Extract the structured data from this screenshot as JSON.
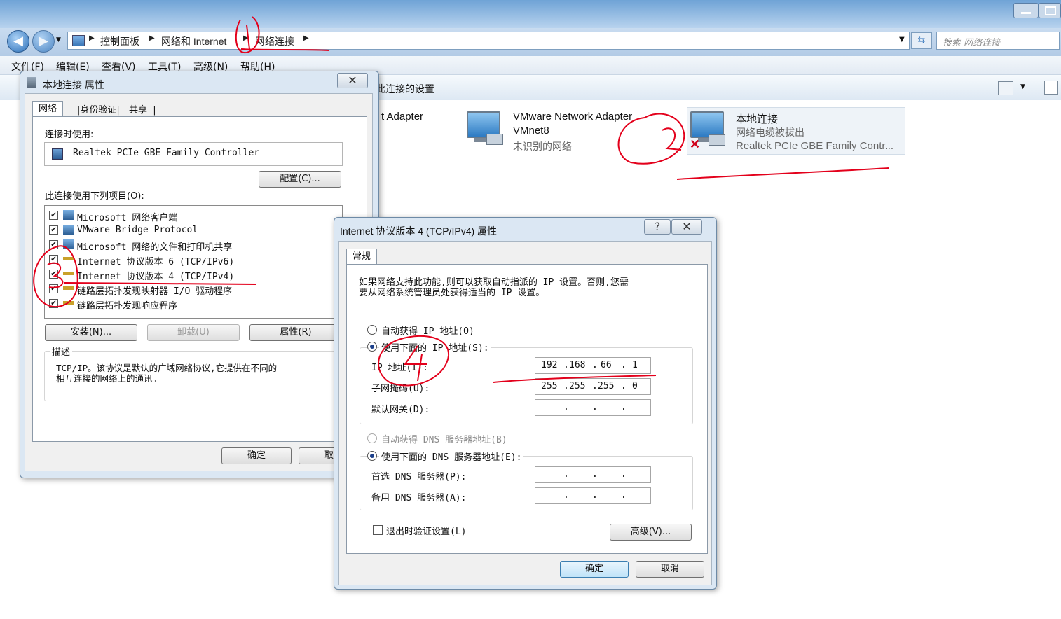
{
  "explorer": {
    "breadcrumb": [
      "控制面板",
      "网络和 Internet",
      "网络连接"
    ],
    "search_placeholder": "搜索 网络连接",
    "menus": [
      "文件(F)",
      "编辑(E)",
      "查看(V)",
      "工具(T)",
      "高级(N)",
      "帮助(H)"
    ],
    "cmd_text": "此连接的设置",
    "adapters": [
      {
        "name": "t Adapter",
        "line2": "",
        "line3": ""
      },
      {
        "name": "VMware Network Adapter",
        "line2": "VMnet8",
        "line3": "未识别的网络"
      },
      {
        "name": "本地连接",
        "line2": "网络电缆被拔出",
        "line3": "Realtek PCIe GBE Family Contr..."
      }
    ]
  },
  "props": {
    "title": "本地连接 属性",
    "close": "✕",
    "tabs": [
      "网络",
      "身份验证",
      "共享"
    ],
    "connect_using_label": "连接时使用:",
    "adapter": "Realtek PCIe GBE Family Controller",
    "configure": "配置(C)...",
    "items_label": "此连接使用下列项目(O):",
    "items": [
      "Microsoft 网络客户端",
      "VMware Bridge Protocol",
      "Microsoft 网络的文件和打印机共享",
      "Internet 协议版本 6 (TCP/IPv6)",
      "Internet 协议版本 4 (TCP/IPv4)",
      "链路层拓扑发现映射器 I/O 驱动程序",
      "链路层拓扑发现响应程序"
    ],
    "install": "安装(N)...",
    "uninstall": "卸载(U)",
    "properties": "属性(R)",
    "desc_title": "描述",
    "desc_text_1": "TCP/IP。该协议是默认的广域网络协议,它提供在不同的",
    "desc_text_2": "相互连接的网络上的通讯。",
    "ok": "确定",
    "cancel": "取消"
  },
  "ipv4": {
    "title": "Internet 协议版本 4 (TCP/IPv4) 属性",
    "help": "?",
    "close": "✕",
    "tab": "常规",
    "intro_1": "如果网络支持此功能,则可以获取自动指派的 IP 设置。否则,您需",
    "intro_2": "要从网络系统管理员处获得适当的 IP 设置。",
    "auto_ip": "自动获得 IP 地址(O)",
    "manual_ip": "使用下面的 IP 地址(S):",
    "ip_label": "IP 地址(I):",
    "ip": [
      "192",
      "168",
      "66",
      "1"
    ],
    "mask_label": "子网掩码(U):",
    "mask": [
      "255",
      "255",
      "255",
      "0"
    ],
    "gw_label": "默认网关(D):",
    "auto_dns": "自动获得 DNS 服务器地址(B)",
    "manual_dns": "使用下面的 DNS 服务器地址(E):",
    "dns1_label": "首选 DNS 服务器(P):",
    "dns2_label": "备用 DNS 服务器(A):",
    "validate": "退出时验证设置(L)",
    "advanced": "高级(V)...",
    "ok": "确定",
    "cancel": "取消"
  },
  "colors": {
    "annotation": "#e3001b",
    "accent": "#2b6fb8"
  }
}
